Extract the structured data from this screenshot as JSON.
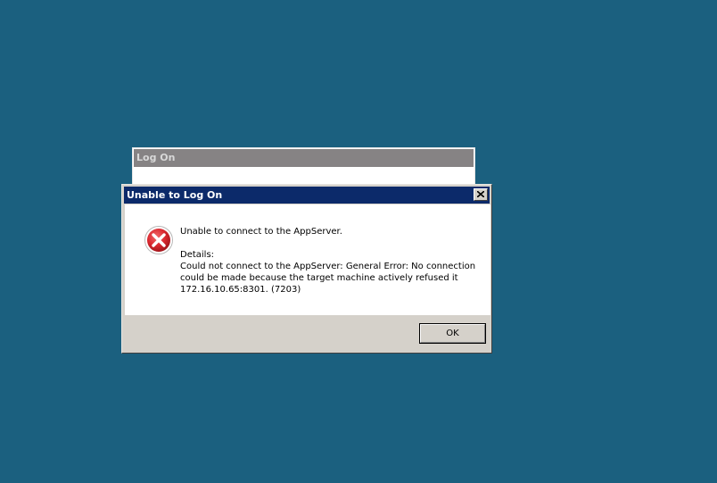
{
  "colors": {
    "desktop_background": "#1b607f",
    "active_titlebar": "#0c2a6a",
    "inactive_titlebar": "#868384",
    "dialog_face": "#d5d1ca",
    "error_red": "#d9272e"
  },
  "background_window": {
    "title": "Log On"
  },
  "dialog": {
    "title": "Unable to Log On",
    "icon": "error-icon",
    "message": "Unable to connect to the AppServer.",
    "details_label": "Details:",
    "details_text": "Could not connect to the AppServer: General Error: No connection\ncould be made because the target machine actively refused it\n172.16.10.65:8301. (7203)",
    "ok_label": "OK",
    "close_icon": "close-icon"
  }
}
